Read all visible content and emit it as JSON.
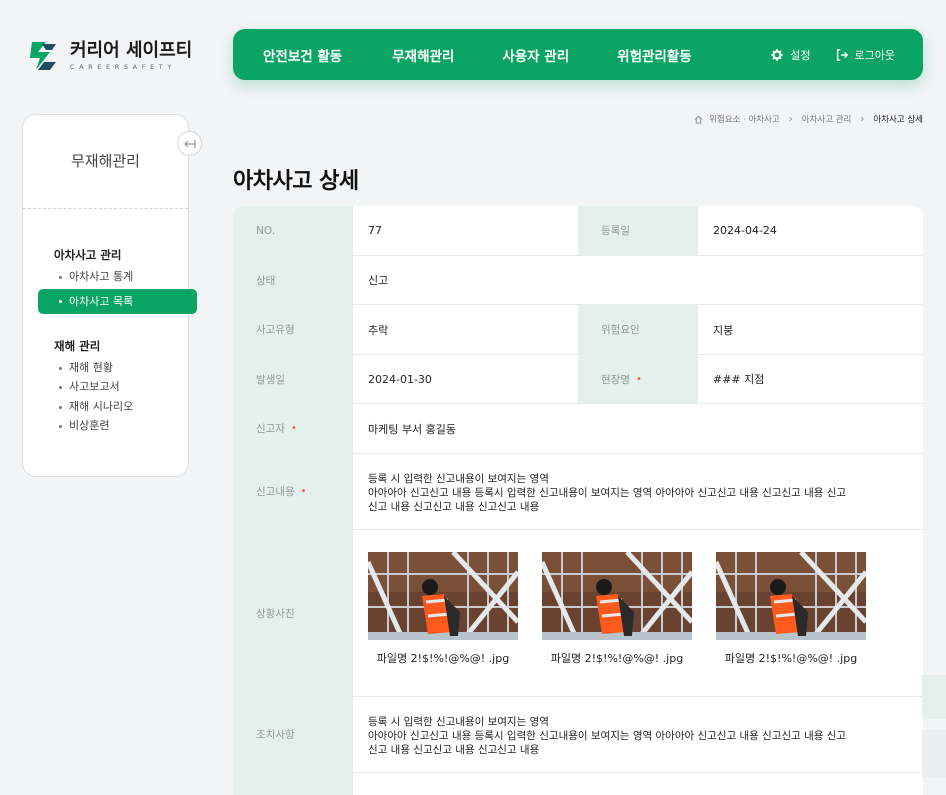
{
  "brand": {
    "name": "커리어 세이프티",
    "sub": "CAREERSAFETY",
    "color": "#0aa564"
  },
  "nav": {
    "items": [
      "안전보건 활동",
      "무재해관리",
      "사용자 관리",
      "위험관리활동"
    ],
    "settings": "설정",
    "logout": "로그아웃"
  },
  "sidebar": {
    "title": "무재해관리",
    "groups": [
      {
        "title": "아차사고 관리",
        "items": [
          "아차사고 통계",
          "아차사고 목록"
        ]
      },
      {
        "title": "재해 관리",
        "items": [
          "재해 현황",
          "사고보고서",
          "재해 시나리오",
          "비상훈련"
        ]
      }
    ],
    "active": "아차사고 목록"
  },
  "breadcrumb": [
    "위험요소 · 아차사고",
    "아차사고 관리",
    "아차사고 상세"
  ],
  "page_title": "아차사고 상세",
  "detail": {
    "no_label": "NO.",
    "no": "77",
    "date_label": "등록일",
    "date": "2024-04-24",
    "status_label": "상태",
    "status": "신고",
    "type_label": "사고유형",
    "type": "추락",
    "risk_label": "위험요인",
    "risk": "지붕",
    "occur_label": "발생일",
    "occur": "2024-01-30",
    "site_label": "현장명",
    "site": "### 지점",
    "reporter_label": "신고자",
    "reporter": "마케팅 부서   홍길동",
    "content_label": "신고내용",
    "content_lines": [
      "등록 시 입력한 신고내용이 보여지는 영역",
      "아아아아 신고신고 내용 등록시 입력한 신고내용이 보여지는 영역 아아아아 신고신고 내용 신고신고 내용 신고",
      "신고 내용 신고신고 내용 신고신고 내용"
    ],
    "photo_label": "상황사진",
    "photos": [
      "파일명 2!$!%!@%@! .jpg",
      "파일명 2!$!%!@%@! .jpg",
      "파일명 2!$!%!@%@! .jpg"
    ],
    "action_label": "조치사항",
    "action_lines": [
      "등록 시 입력한 신고내용이 보여지는 영역",
      "아아아아 신고신고 내용 등록시 입력한 신고내용이 보여지는 영역 아아아아 신고신고 내용 신고신고 내용 신고",
      "신고 내용 신고신고 내용 신고신고 내용"
    ]
  }
}
